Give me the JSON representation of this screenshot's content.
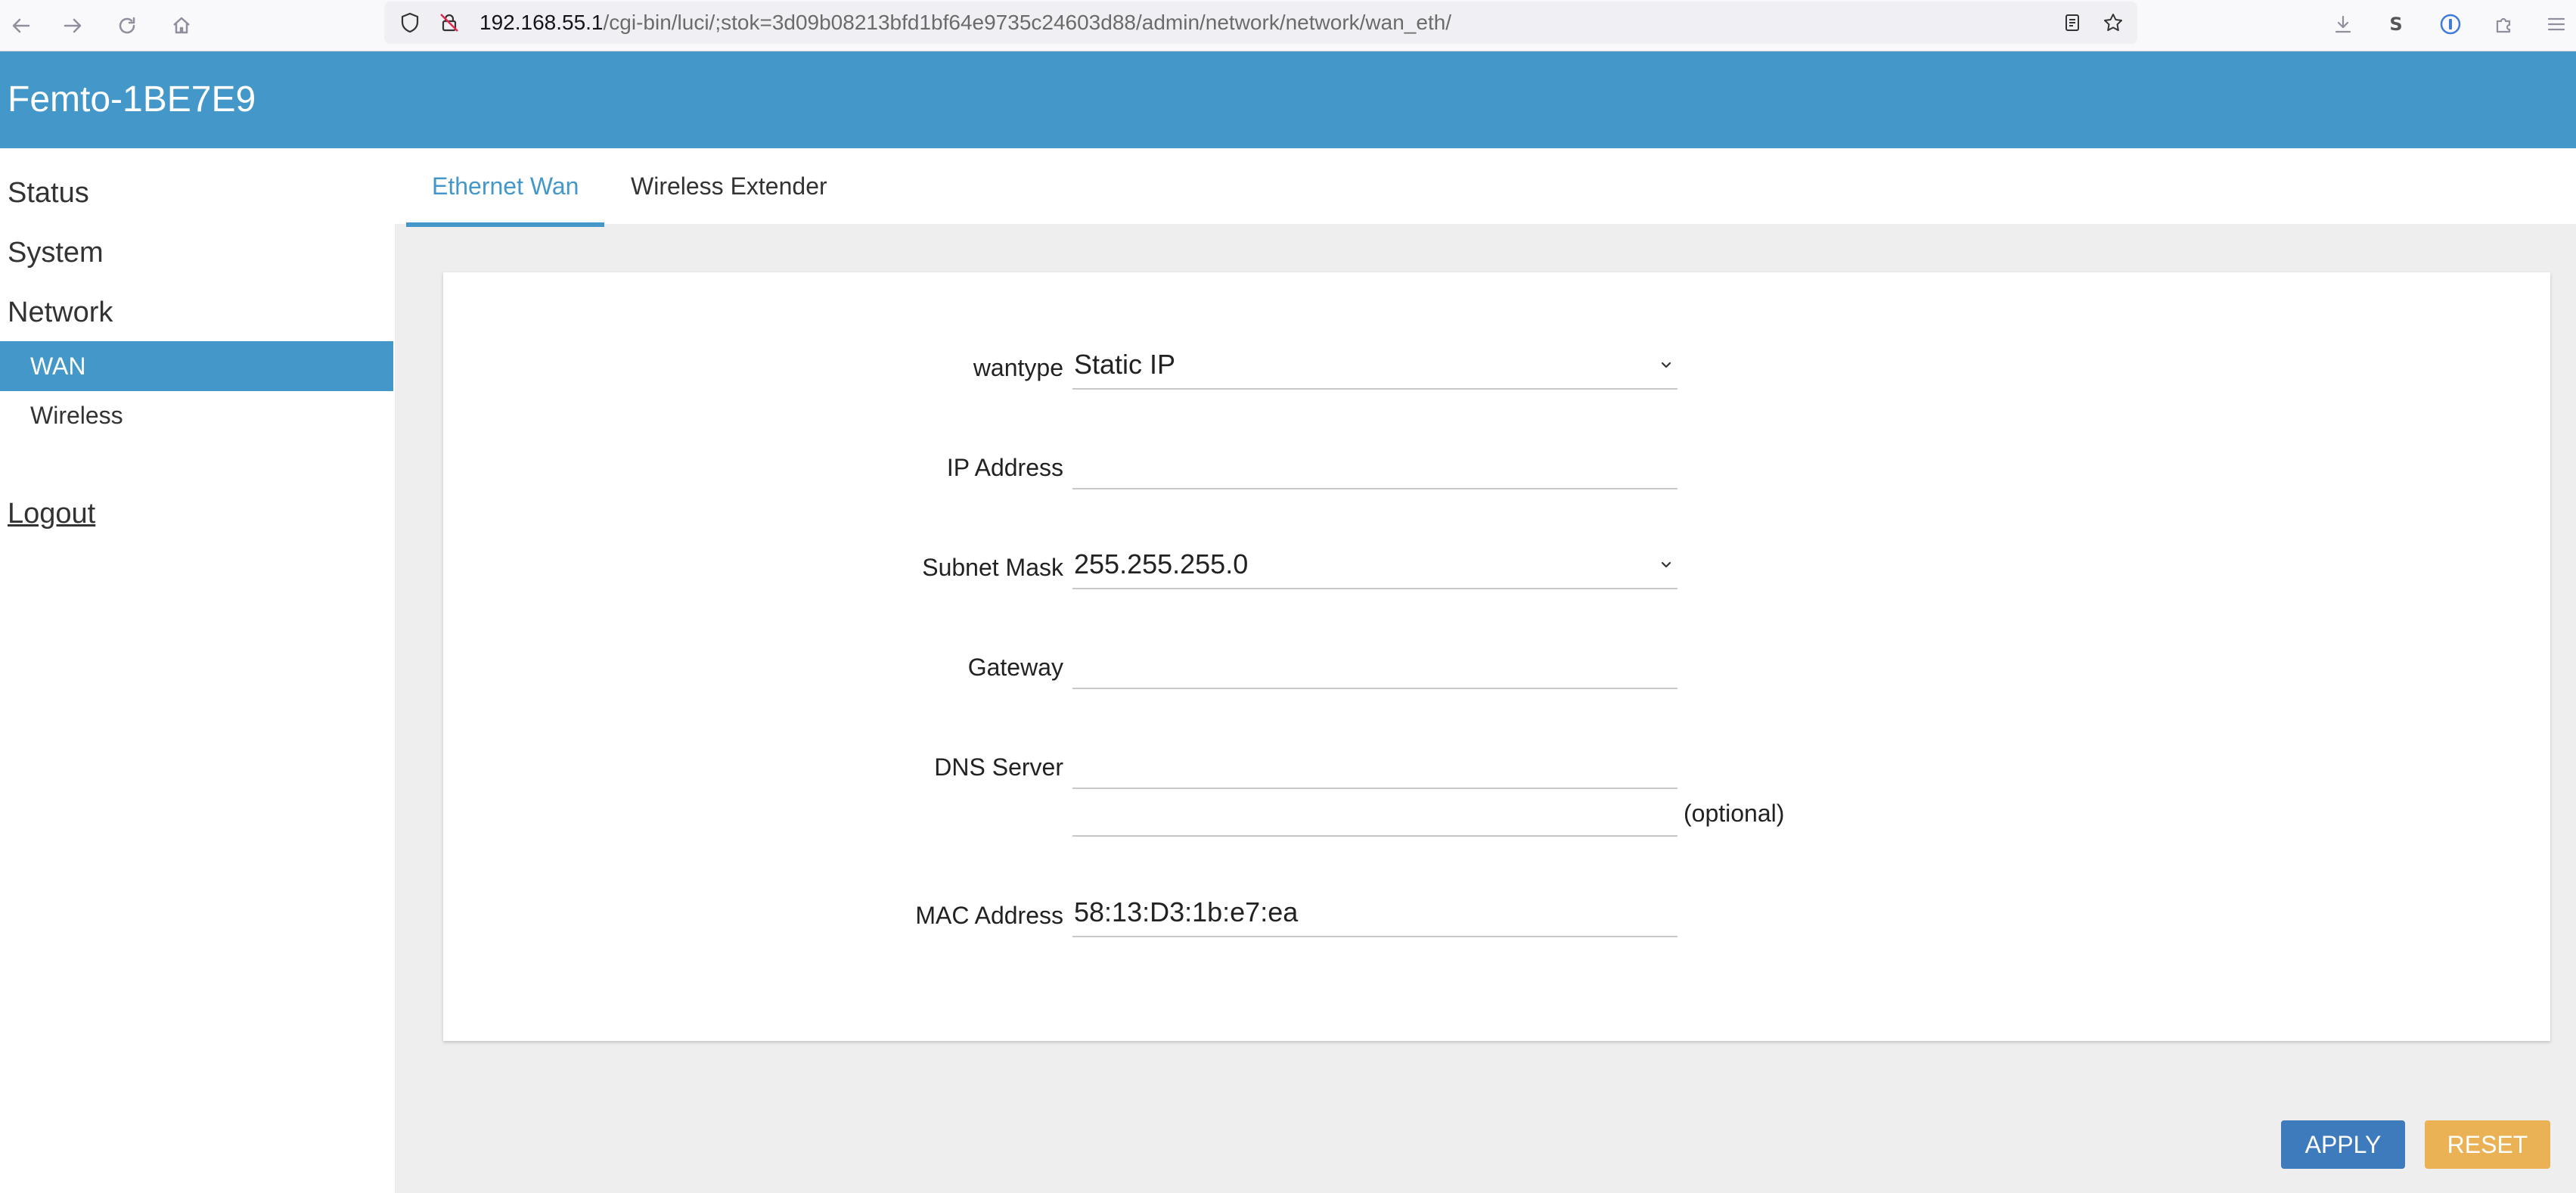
{
  "browser": {
    "url_host": "192.168.55.1",
    "url_path": "/cgi-bin/luci/;stok=3d09b08213bfd1bf64e9735c24603d88/admin/network/network/wan_eth/"
  },
  "header": {
    "title": "Femto-1BE7E9"
  },
  "sidebar": {
    "status": "Status",
    "system": "System",
    "network": "Network",
    "wan": "WAN",
    "wireless": "Wireless",
    "logout": "Logout"
  },
  "tabs": {
    "ethernet_wan": "Ethernet Wan",
    "wireless_extender": "Wireless Extender"
  },
  "form": {
    "wantype_label": "wantype",
    "wantype_value": "Static IP",
    "ip_label": "IP Address",
    "ip_value": "",
    "subnet_label": "Subnet Mask",
    "subnet_value": "255.255.255.0",
    "gateway_label": "Gateway",
    "gateway_value": "",
    "dns_label": "DNS Server",
    "dns1_value": "",
    "dns2_value": "",
    "optional_note": "(optional)",
    "mac_label": "MAC Address",
    "mac_value": "58:13:D3:1b:e7:ea"
  },
  "buttons": {
    "apply": "APPLY",
    "reset": "RESET"
  },
  "colors": {
    "accent": "#4498c9",
    "apply": "#3d7bbd",
    "reset": "#eab155",
    "content_bg": "#eeeeee"
  }
}
